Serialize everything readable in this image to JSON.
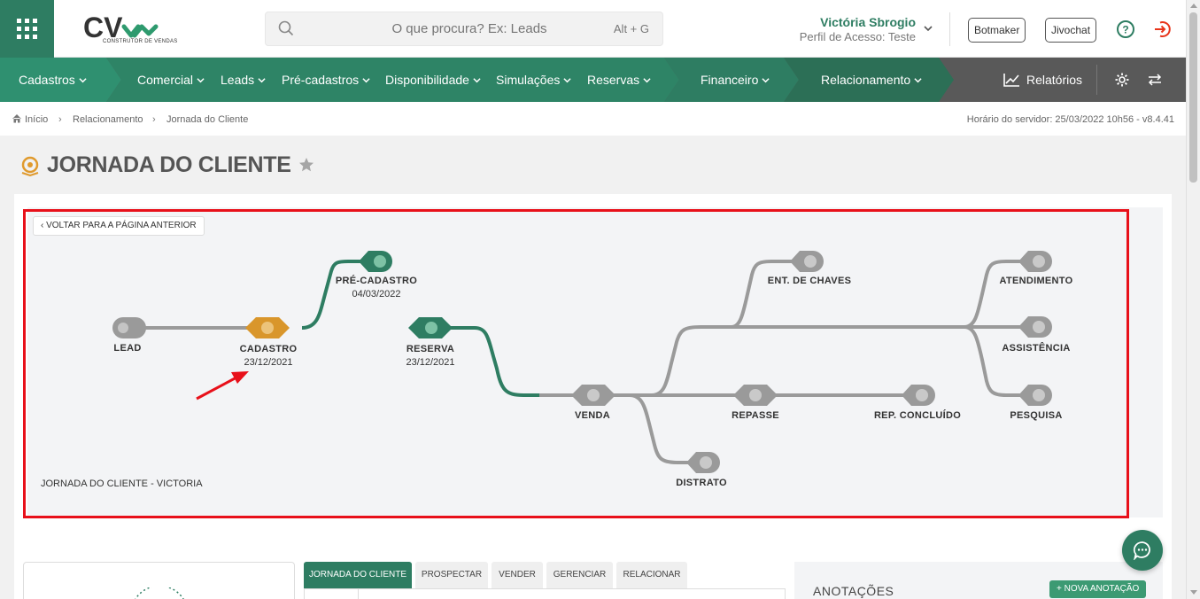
{
  "header": {
    "search": {
      "placeholder": "O que procura? Ex: Leads",
      "shortcut": "Alt + G"
    },
    "logo_subtitle": "CONSTRUTOR DE VENDAS",
    "user": {
      "name": "Victória Sbrogio",
      "role": "Perfil de Acesso: Teste"
    },
    "buttons": {
      "botmaker": "Botmaker",
      "jivochat": "Jivochat"
    },
    "icons": [
      "apps-grid-icon",
      "search-icon",
      "chevron-down-icon",
      "help-icon",
      "logout-icon"
    ]
  },
  "nav": {
    "items": [
      {
        "label": "Cadastros"
      },
      {
        "label": "Comercial"
      },
      {
        "label": "Leads"
      },
      {
        "label": "Pré-cadastros"
      },
      {
        "label": "Disponibilidade"
      },
      {
        "label": "Simulações"
      },
      {
        "label": "Reservas"
      },
      {
        "label": "Financeiro"
      },
      {
        "label": "Relacionamento"
      }
    ],
    "reports": "Relatórios"
  },
  "breadcrumb": {
    "items": [
      "Início",
      "Relacionamento",
      "Jornada do Cliente"
    ],
    "server_time": "Horário do servidor: 25/03/2022 10h56 - v8.4.41"
  },
  "page": {
    "title": "JORNADA DO CLIENTE"
  },
  "journey": {
    "back_label": "VOLTAR PARA A PÁGINA ANTERIOR",
    "caption": "JORNADA DO CLIENTE - VICTORIA",
    "nodes": {
      "lead": {
        "label": "LEAD",
        "state": "inactive"
      },
      "cadastro": {
        "label": "CADASTRO",
        "date": "23/12/2021",
        "state": "current"
      },
      "pre_cadastro": {
        "label": "PRÉ-CADASTRO",
        "date": "04/03/2022",
        "state": "done"
      },
      "reserva": {
        "label": "RESERVA",
        "date": "23/12/2021",
        "state": "done"
      },
      "venda": {
        "label": "VENDA",
        "state": "inactive"
      },
      "distrato": {
        "label": "DISTRATO",
        "state": "inactive"
      },
      "ent_chaves": {
        "label": "ENT. DE CHAVES",
        "state": "inactive"
      },
      "repasse": {
        "label": "REPASSE",
        "state": "inactive"
      },
      "rep_concluido": {
        "label": "REP. CONCLUÍDO",
        "state": "inactive"
      },
      "atendimento": {
        "label": "ATENDIMENTO",
        "state": "inactive"
      },
      "assistencia": {
        "label": "ASSISTÊNCIA",
        "state": "inactive"
      },
      "pesquisa": {
        "label": "PESQUISA",
        "state": "inactive"
      }
    },
    "colors": {
      "done": "#2e7d62",
      "current": "#d9962b",
      "inactive": "#9a9a9a",
      "highlight": "#e8101a"
    }
  },
  "tabs": [
    "JORNADA DO CLIENTE",
    "PROSPECTAR",
    "VENDER",
    "GERENCIAR",
    "RELACIONAR"
  ],
  "notes": {
    "title": "ANOTAÇÕES",
    "new_button": "+ NOVA ANOTAÇÃO"
  }
}
